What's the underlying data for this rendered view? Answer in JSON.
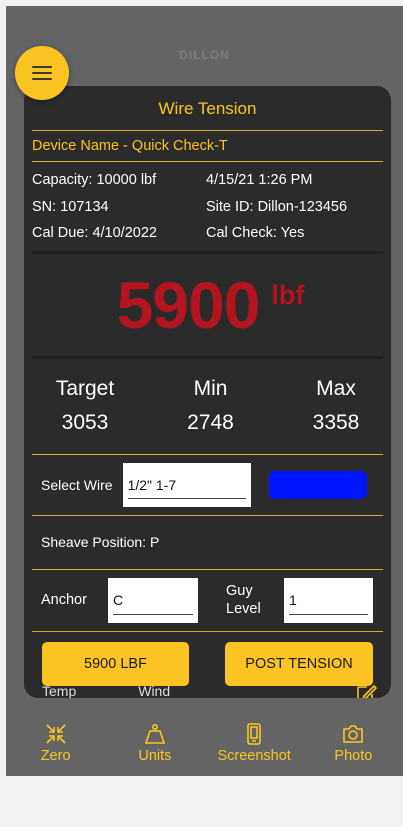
{
  "brand": "DILLON",
  "card": {
    "title": "Wire Tension",
    "device_label": "Device Name  -  Quick Check-T",
    "capacity": "Capacity: 10000 lbf",
    "datetime": "4/15/21 1:26 PM",
    "sn": "SN: 107134",
    "site_id": "Site ID: Dillon-123456",
    "cal_due": "Cal Due:  4/10/2022",
    "cal_check": "Cal Check: Yes"
  },
  "reading": {
    "value": "5900",
    "unit": "lbf",
    "color": "#b4141f"
  },
  "limits": {
    "target_label": "Target",
    "target_value": "3053",
    "min_label": "Min",
    "min_value": "2748",
    "max_label": "Max",
    "max_value": "3358"
  },
  "wire": {
    "label": "Select Wire",
    "value": "1/2\" 1-7",
    "swatch_color": "#0015ff"
  },
  "sheave": {
    "label": "Sheave Position:  P"
  },
  "anchor": {
    "label": "Anchor",
    "value": "C",
    "guy_label_1": "Guy",
    "guy_label_2": "Level",
    "guy_value": "1"
  },
  "buttons": {
    "reading": "5900 LBF",
    "post": "POST TENSION"
  },
  "peek": {
    "temp": "Temp",
    "wind": "Wind",
    "edit_icon": "edit-icon"
  },
  "tabs": [
    {
      "label": "Zero",
      "icon": "zero-icon"
    },
    {
      "label": "Units",
      "icon": "weight-icon"
    },
    {
      "label": "Screenshot",
      "icon": "phone-icon"
    },
    {
      "label": "Photo",
      "icon": "camera-icon"
    }
  ],
  "accent_color": "#fcc422"
}
